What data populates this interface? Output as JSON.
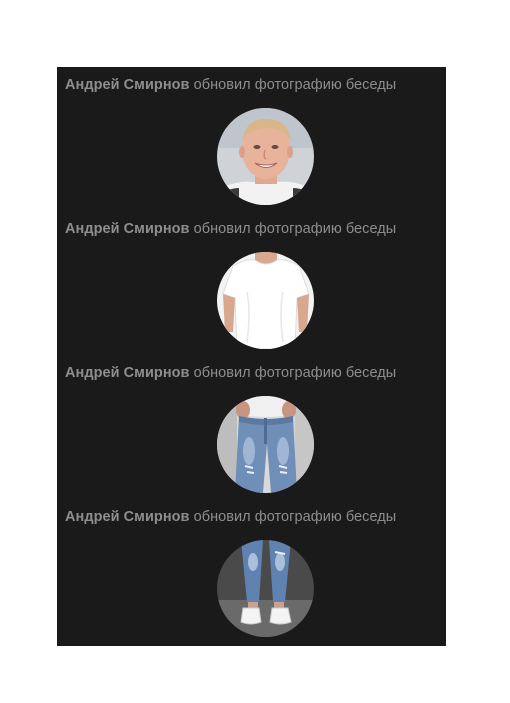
{
  "events": [
    {
      "author": "Андрей Смирнов",
      "action": "обновил фотографию беседы",
      "photo": "face-portrait"
    },
    {
      "author": "Андрей Смирнов",
      "action": "обновил фотографию беседы",
      "photo": "white-tshirt"
    },
    {
      "author": "Андрей Смирнов",
      "action": "обновил фотографию беседы",
      "photo": "jeans-torso"
    },
    {
      "author": "Андрей Смирнов",
      "action": "обновил фотографию беседы",
      "photo": "jeans-legs-sneakers"
    }
  ],
  "colors": {
    "background": "#1a1a1a",
    "text": "#8e8e8e"
  }
}
